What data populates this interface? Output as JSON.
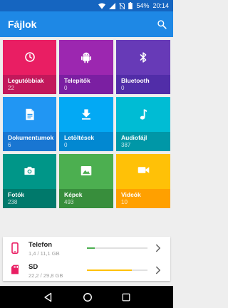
{
  "status_bar": {
    "battery": "54%",
    "time": "20:14"
  },
  "app_bar": {
    "title": "Fájlok",
    "search_icon": "search-icon"
  },
  "categories": [
    {
      "label": "Legutóbbiak",
      "count": "22",
      "icon": "clock-icon",
      "color": "#e91e63",
      "footer_color": "#c2185b"
    },
    {
      "label": "Telepítők",
      "count": "0",
      "icon": "android-icon",
      "color": "#9c27b0",
      "footer_color": "#7b1fa2"
    },
    {
      "label": "Bluetooth",
      "count": "0",
      "icon": "bluetooth-icon",
      "color": "#673ab7",
      "footer_color": "#512da8"
    },
    {
      "label": "Dokumentumok",
      "count": "6",
      "icon": "document-icon",
      "color": "#2196f3",
      "footer_color": "#1976d2"
    },
    {
      "label": "Letöltések",
      "count": "0",
      "icon": "download-icon",
      "color": "#03a9f4",
      "footer_color": "#0288d1"
    },
    {
      "label": "Audiofájl",
      "count": "387",
      "icon": "music-note-icon",
      "color": "#00bcd4",
      "footer_color": "#0097a7"
    },
    {
      "label": "Fotók",
      "count": "238",
      "icon": "camera-icon",
      "color": "#009688",
      "footer_color": "#00796b"
    },
    {
      "label": "Képek",
      "count": "493",
      "icon": "image-icon",
      "color": "#4caf50",
      "footer_color": "#388e3c"
    },
    {
      "label": "Videók",
      "count": "10",
      "icon": "video-camera-icon",
      "color": "#ffc107",
      "footer_color": "#ffa000"
    }
  ],
  "storage": [
    {
      "name": "Telefon",
      "usage": "1,4 / 11,1 GB",
      "fraction": 0.126,
      "icon": "phone-icon",
      "color": "#e91e63",
      "bar_color": "#4caf50"
    },
    {
      "name": "SD",
      "usage": "22,2 / 29,8 GB",
      "fraction": 0.745,
      "icon": "sd-card-icon",
      "color": "#e91e63",
      "bar_color": "#ffc107"
    }
  ],
  "nav": {
    "back_icon": "back-icon",
    "home_icon": "home-icon",
    "recents_icon": "recents-icon"
  }
}
